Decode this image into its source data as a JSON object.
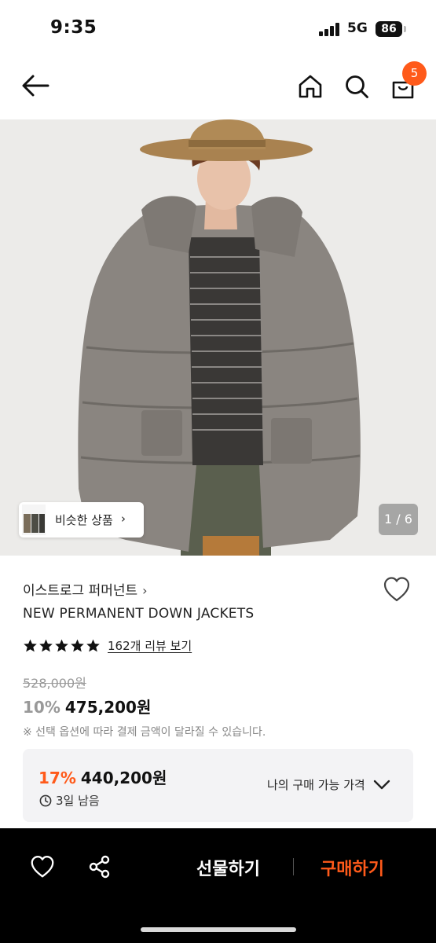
{
  "status_bar": {
    "time": "9:35",
    "network": "5G",
    "battery": "86"
  },
  "nav": {
    "back_icon": "arrow-left-icon",
    "home_icon": "home-icon",
    "search_icon": "search-icon",
    "cart_icon": "shopping-bag-icon",
    "cart_count": "5"
  },
  "product_image": {
    "similar_label": "비슷한 상품",
    "page_indicator": "1 / 6"
  },
  "product": {
    "brand": "이스트로그 퍼머넌트",
    "name": "NEW PERMANENT DOWN JACKETS",
    "rating_stars": 5,
    "review_link": "162개 리뷰 보기",
    "original_price": "528,000원",
    "discount_rate": "10%",
    "sale_price": "475,200원",
    "notice": "※ 선택 옵션에 따라 결제 금액이 달라질 수 있습니다."
  },
  "my_price": {
    "discount_rate": "17%",
    "price": "440,200원",
    "remaining": "3일 남음",
    "toggle_label": "나의 구매 가능 가격"
  },
  "bottom_bar": {
    "gift_label": "선물하기",
    "buy_label": "구매하기"
  },
  "colors": {
    "accent": "#ff5a1a",
    "bottom_bar": "#000000"
  }
}
